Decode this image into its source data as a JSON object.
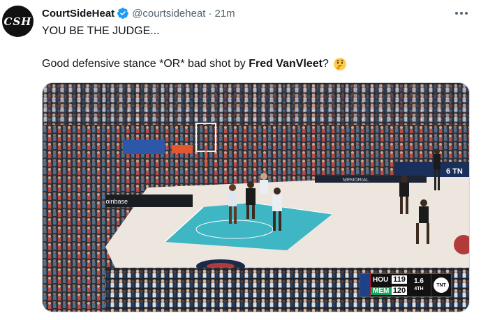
{
  "author": {
    "avatar_text": "CSH",
    "display_name": "CourtSideHeat",
    "handle": "@courtsideheat",
    "separator": "·",
    "time": "21m",
    "verified_color": "#1d9bf0"
  },
  "tweet": {
    "line1": "YOU BE THE JUDGE...",
    "line2_prefix": "Good defensive stance *OR* bad shot by ",
    "line2_bold": "Fred VanVleet",
    "line2_suffix": "?",
    "emoji": "thinking-face"
  },
  "media": {
    "scorebug": {
      "team_home": "HOU",
      "score_home": "119",
      "team_away": "MEM",
      "score_away": "120",
      "time": "1.6",
      "period": "4TH",
      "network": "TNT"
    },
    "court_signage": [
      "coinbase",
      "6 TN",
      "MEMORIAL"
    ],
    "colors": {
      "court_paint": "#3fb6c4",
      "hardwood": "#ece6df",
      "crowd": "#2a2f38"
    }
  }
}
